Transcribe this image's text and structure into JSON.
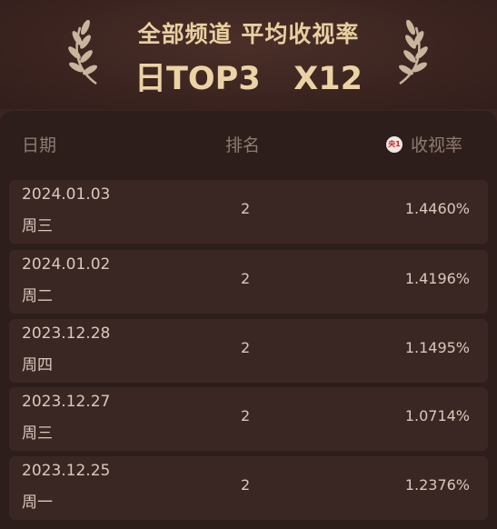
{
  "header": {
    "title": "全部频道 平均收视率",
    "subtitle": "日TOP3   X12"
  },
  "table": {
    "col_date": "日期",
    "col_rank": "排名",
    "col_rate": "收视率",
    "channel_badge": "央1",
    "rows": [
      {
        "date": "2024.01.03",
        "weekday": "周三",
        "rank": "2",
        "rate": "1.4460%"
      },
      {
        "date": "2024.01.02",
        "weekday": "周二",
        "rank": "2",
        "rate": "1.4196%"
      },
      {
        "date": "2023.12.28",
        "weekday": "周四",
        "rank": "2",
        "rate": "1.1495%"
      },
      {
        "date": "2023.12.27",
        "weekday": "周三",
        "rank": "2",
        "rate": "1.0714%"
      },
      {
        "date": "2023.12.25",
        "weekday": "周一",
        "rank": "2",
        "rate": "1.2376%"
      }
    ]
  },
  "colors": {
    "gold": "#e9cfa0",
    "background": "#3a2420",
    "card": "#2e1e1b",
    "row": "#3a2723"
  }
}
